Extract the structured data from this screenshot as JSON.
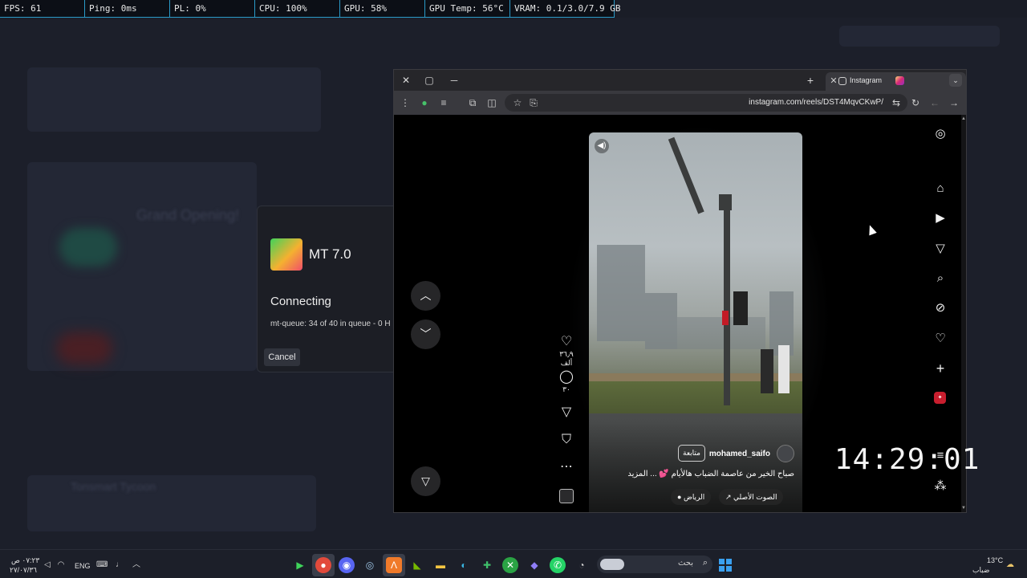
{
  "perf_overlay": {
    "fps": "FPS: 61",
    "ping": "Ping: 0ms",
    "pl": "PL: 0%",
    "cpu": "CPU: 100%",
    "gpu": "GPU: 58%",
    "gpu_temp": "GPU Temp: 56°C",
    "vram": "VRAM: 0.1/3.0/7.9 GB"
  },
  "background_app": {
    "heading": "Grand Opening!",
    "subheading": "Tonsmart Tycoon"
  },
  "mt_dialog": {
    "title": "MT 7.0",
    "status": "Connecting",
    "queue": "mt-queue: 34 of 40 in queue - 0 H",
    "cancel_label": "Cancel"
  },
  "browser": {
    "tab_title": "Instagram",
    "url": "instagram.com/reels/DST4MqvCKwP/"
  },
  "reel": {
    "username": "mohamed_saifo",
    "follow_label": "متابعة",
    "caption": "صباح الخير من عاصمة الضباب هالأيام 💕 ... المزيد",
    "audio_label": "الصوت الأصلي",
    "location_label": "الرياض",
    "likes": "٣٦٫٩ ألف",
    "comments": "٣٠"
  },
  "desktop": {
    "clock": "14:29:01"
  },
  "taskbar": {
    "time": "٠٧:٢٣ ص",
    "date": "٢٧/٠٧/٣٦",
    "language": "ENG",
    "search_placeholder": "بحث",
    "weather_temp": "13°C",
    "weather_desc": "ضباب"
  },
  "colors": {
    "accent": "#2a9ac8",
    "instagram_gradient": "#d62976",
    "windows_blue": "#3aa0f0"
  },
  "icons": {
    "nav": [
      "home-icon",
      "reels-icon",
      "send-icon",
      "search-icon",
      "explore-icon",
      "heart-icon",
      "plus-icon",
      "more-icon",
      "apps-icon"
    ]
  }
}
